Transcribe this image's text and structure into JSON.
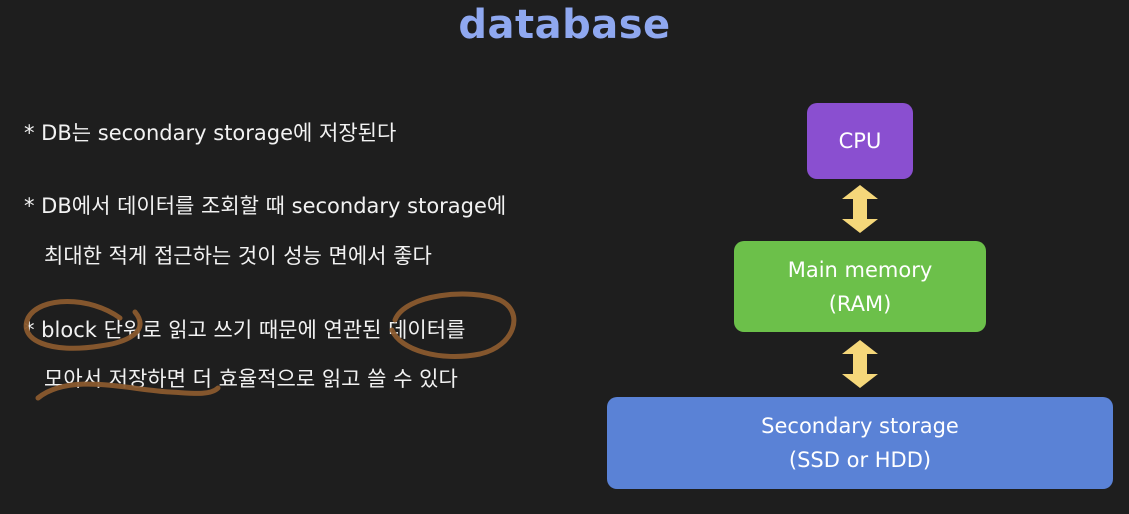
{
  "title": "database",
  "bullets": [
    {
      "lines": [
        "* DB는 secondary storage에 저장된다"
      ]
    },
    {
      "lines": [
        "* DB에서 데이터를 조회할 때 secondary storage에",
        "최대한 적게 접근하는 것이 성능 면에서 좋다"
      ]
    },
    {
      "lines": [
        "* block 단위로 읽고 쓰기 때문에 연관된 데이터를",
        "모아서 저장하면 더 효율적으로 읽고 쓸 수 있다"
      ]
    }
  ],
  "diagram": {
    "cpu": {
      "label": "CPU"
    },
    "ram": {
      "line1": "Main memory",
      "line2": "(RAM)"
    },
    "storage": {
      "line1": "Secondary storage",
      "line2": "(SSD or HDD)"
    }
  },
  "colors": {
    "title": "#8fa8f0",
    "cpu": "#8a4fd0",
    "ram": "#6cc04a",
    "storage": "#5a82d6",
    "arrow": "#f5d77a",
    "annotation": "#8a5a2e"
  },
  "icons": [
    "double-arrow-icon",
    "handwritten-annotation"
  ]
}
